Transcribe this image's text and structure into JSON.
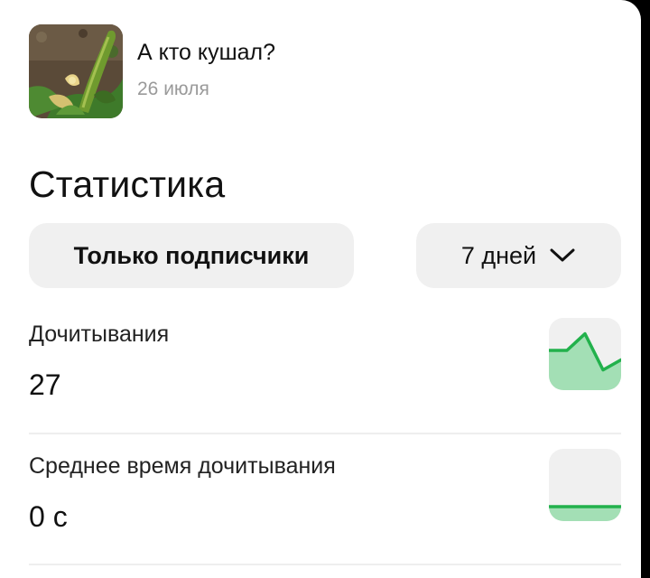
{
  "post": {
    "title": "А кто кушал?",
    "date": "26 июля",
    "thumbnail": "zucchini-plant-photo"
  },
  "statistics": {
    "title": "Статистика",
    "audience_filter": "Только подписчики",
    "period": {
      "selected": "7 дней",
      "icon": "chevron-down-icon"
    },
    "metrics": [
      {
        "label": "Дочитывания",
        "value": "27",
        "trend": [
          0.55,
          0.55,
          0.78,
          0.28,
          0.42
        ]
      },
      {
        "label": "Среднее время дочитывания",
        "value": "0 с",
        "trend": [
          0.2,
          0.2
        ]
      }
    ]
  },
  "colors": {
    "accent_green": "#22b14c",
    "sparkline_fill": "#a3dfb5",
    "pill_background": "#f0f0f0",
    "secondary_text": "#9a9a9a"
  }
}
